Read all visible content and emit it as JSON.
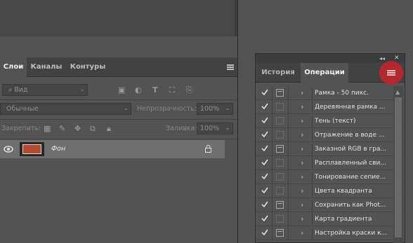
{
  "layers_panel": {
    "tabs": [
      {
        "label": "Слои",
        "active": true
      },
      {
        "label": "Каналы",
        "active": false
      },
      {
        "label": "Контуры",
        "active": false
      }
    ],
    "filter": {
      "value": "Вид"
    },
    "blend_mode": {
      "value": "Обычные"
    },
    "opacity": {
      "label": "Непрозрачность:",
      "value": "100%"
    },
    "lock": {
      "label": "Закрепить:"
    },
    "fill": {
      "label": "Заливка:",
      "value": "100%"
    },
    "layers": [
      {
        "name": "Фон",
        "visible": true,
        "locked": true
      }
    ]
  },
  "operations_panel": {
    "tabs": [
      {
        "label": "История",
        "active": false
      },
      {
        "label": "Операции",
        "active": true
      }
    ],
    "actions": [
      {
        "name": "Рамка - 50 пикс.",
        "enabled": true,
        "dialog": true
      },
      {
        "name": "Деревянная рамка ...",
        "enabled": true,
        "dialog": false
      },
      {
        "name": "Тень (текст)",
        "enabled": true,
        "dialog": false
      },
      {
        "name": "Отражение в воде ...",
        "enabled": true,
        "dialog": false
      },
      {
        "name": "Заказной RGB в гра...",
        "enabled": true,
        "dialog": true
      },
      {
        "name": "Расплавленный сви...",
        "enabled": true,
        "dialog": false
      },
      {
        "name": "Тонирование сепие...",
        "enabled": true,
        "dialog": false
      },
      {
        "name": "Цвета квадранта",
        "enabled": true,
        "dialog": false
      },
      {
        "name": "Сохранить как Phot...",
        "enabled": true,
        "dialog": true
      },
      {
        "name": "Карта градиента",
        "enabled": true,
        "dialog": false
      },
      {
        "name": "Настройка краски к...",
        "enabled": true,
        "dialog": true
      }
    ]
  },
  "colors": {
    "highlight": "#c0262c"
  }
}
